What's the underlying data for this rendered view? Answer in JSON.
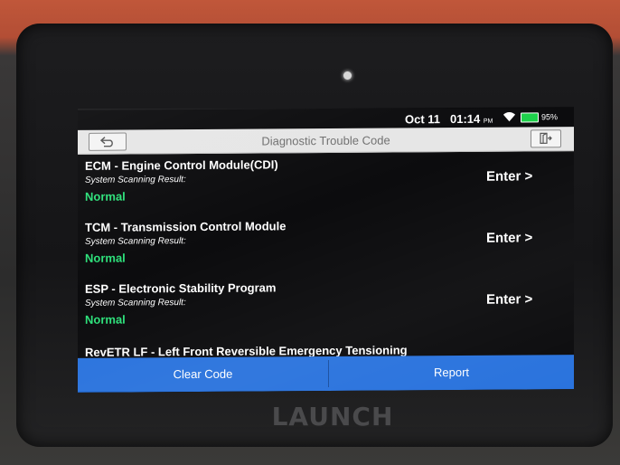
{
  "device": {
    "brand": "LAUNCH"
  },
  "status_bar": {
    "date": "Oct 11",
    "time": "01:14",
    "ampm": "PM",
    "battery": "95%"
  },
  "header": {
    "title": "Diagnostic Trouble Code"
  },
  "modules": [
    {
      "name": "ECM - Engine Control Module(CDI)",
      "sub": "System Scanning Result:",
      "status": "Normal",
      "action": "Enter >"
    },
    {
      "name": "TCM - Transmission Control Module",
      "sub": "System Scanning Result:",
      "status": "Normal",
      "action": "Enter >"
    },
    {
      "name": "ESP - Electronic Stability Program",
      "sub": "System Scanning Result:",
      "status": "Normal",
      "action": "Enter >"
    },
    {
      "name": "RevETR LF - Left Front Reversible Emergency Tensioning",
      "sub": "",
      "status": "",
      "action": ""
    }
  ],
  "footer": {
    "clear_label": "Clear Code",
    "report_label": "Report"
  },
  "colors": {
    "accent": "#2a73dd",
    "normal_status": "#2de07a",
    "battery": "#1ed14b"
  }
}
